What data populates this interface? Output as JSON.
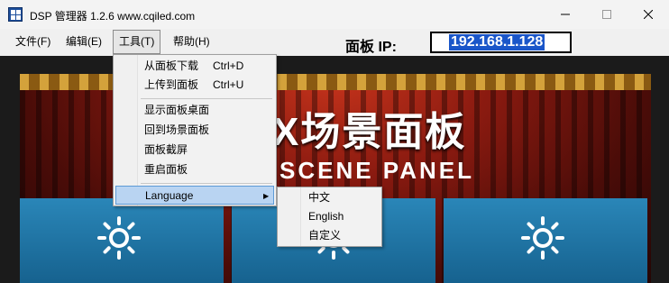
{
  "window": {
    "title": "DSP 管理器 1.2.6 www.cqiled.com",
    "icon": "app-logo-icon"
  },
  "menubar": {
    "items": [
      {
        "label": "文件(F)"
      },
      {
        "label": "编辑(E)"
      },
      {
        "label": "工具(T)"
      },
      {
        "label": "帮助(H)"
      }
    ]
  },
  "panel_ip": {
    "label": "面板 IP:",
    "value": "192.168.1.128"
  },
  "tools_menu": {
    "items": [
      {
        "label": "从面板下载",
        "shortcut": "Ctrl+D"
      },
      {
        "label": "上传到面板",
        "shortcut": "Ctrl+U"
      },
      {
        "label": "显示面板桌面"
      },
      {
        "label": "回到场景面板"
      },
      {
        "label": "面板截屏"
      },
      {
        "label": "重启面板"
      },
      {
        "label": "Language",
        "submenu_arrow": "▶"
      }
    ]
  },
  "language_menu": {
    "items": [
      {
        "label": "中文"
      },
      {
        "label": "English"
      },
      {
        "label": "自定义"
      }
    ]
  },
  "scene": {
    "title": "X场景面板",
    "subtitle": "SCENE PANEL",
    "tiles": [
      {
        "icon": "sun-icon"
      },
      {
        "icon": "sun-icon"
      },
      {
        "icon": "sun-icon"
      }
    ]
  },
  "colors": {
    "selection": "#1a56c9",
    "menu_highlight": "#b9d4f2",
    "tile_blue": "#2a86b8",
    "stage_red": "#8a1a10"
  }
}
